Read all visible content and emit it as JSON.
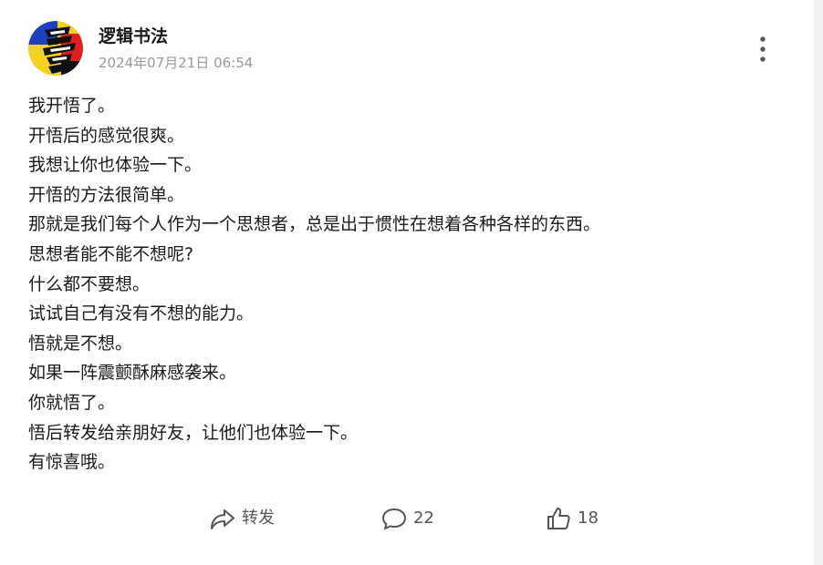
{
  "post": {
    "author": "逻辑书法",
    "timestamp": "2024年07月21日 06:54",
    "content_lines": [
      "我开悟了。",
      "开悟后的感觉很爽。",
      "我想让你也体验一下。",
      "开悟的方法很简单。",
      "那就是我们每个人作为一个思想者，总是出于惯性在想着各种各样的东西。",
      "思想者能不能不想呢?",
      "什么都不要想。",
      "试试自己有没有不想的能力。",
      "悟就是不想。",
      "如果一阵震颤酥麻感袭来。",
      "你就悟了。",
      "悟后转发给亲朋好友，让他们也体验一下。",
      "有惊喜哦。"
    ]
  },
  "actions": {
    "share_label": "转发",
    "comment_count": "22",
    "like_count": "18"
  },
  "icons": {
    "more": "more-vertical-icon",
    "share": "share-arrow-icon",
    "comment": "comment-bubble-icon",
    "like": "thumbs-up-icon"
  },
  "colors": {
    "text": "#1a1a1a",
    "secondary": "#999999",
    "icon": "#555555",
    "avatar_yellow": "#f4d21f",
    "avatar_blue": "#1f3fbf",
    "avatar_red": "#e0201e"
  }
}
